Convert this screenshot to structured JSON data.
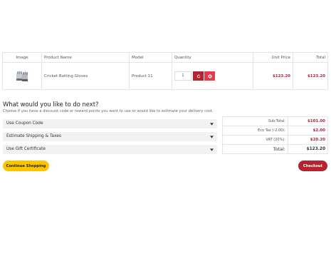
{
  "cart": {
    "columns": {
      "image": "Image",
      "product_name": "Product Name",
      "model": "Model",
      "quantity": "Quantity",
      "unit_price": "Unit Price",
      "total": "Total"
    },
    "items": [
      {
        "product_name": "Cricket Batting Gloves",
        "model": "Product 11",
        "quantity": "1",
        "unit_price": "$123.20",
        "total": "$123.20",
        "image_icon": "cricket-gloves-icon"
      }
    ],
    "update_icon": "refresh-icon",
    "remove_icon": "remove-icon"
  },
  "next_steps": {
    "heading": "What would you like to do next?",
    "description": "Choose if you have a discount code or reward points you want to use or would like to estimate your delivery cost.",
    "panels": [
      {
        "label": "Use Coupon Code"
      },
      {
        "label": "Estimate Shipping & Taxes"
      },
      {
        "label": "Use Gift Certificate"
      }
    ]
  },
  "totals": {
    "rows": [
      {
        "label": "Sub-Total:",
        "amount": "$101.00"
      },
      {
        "label": "Eco Tax (-2.00):",
        "amount": "$2.00"
      },
      {
        "label": "VAT (20%):",
        "amount": "$20.20"
      },
      {
        "label": "Total:",
        "amount": "$123.20"
      }
    ]
  },
  "actions": {
    "continue_label": "Continue Shopping",
    "checkout_label": "Checkout"
  },
  "colors": {
    "brand_red": "#b32330",
    "price_red": "#b0233a",
    "continue_yellow": "#ffc400"
  }
}
